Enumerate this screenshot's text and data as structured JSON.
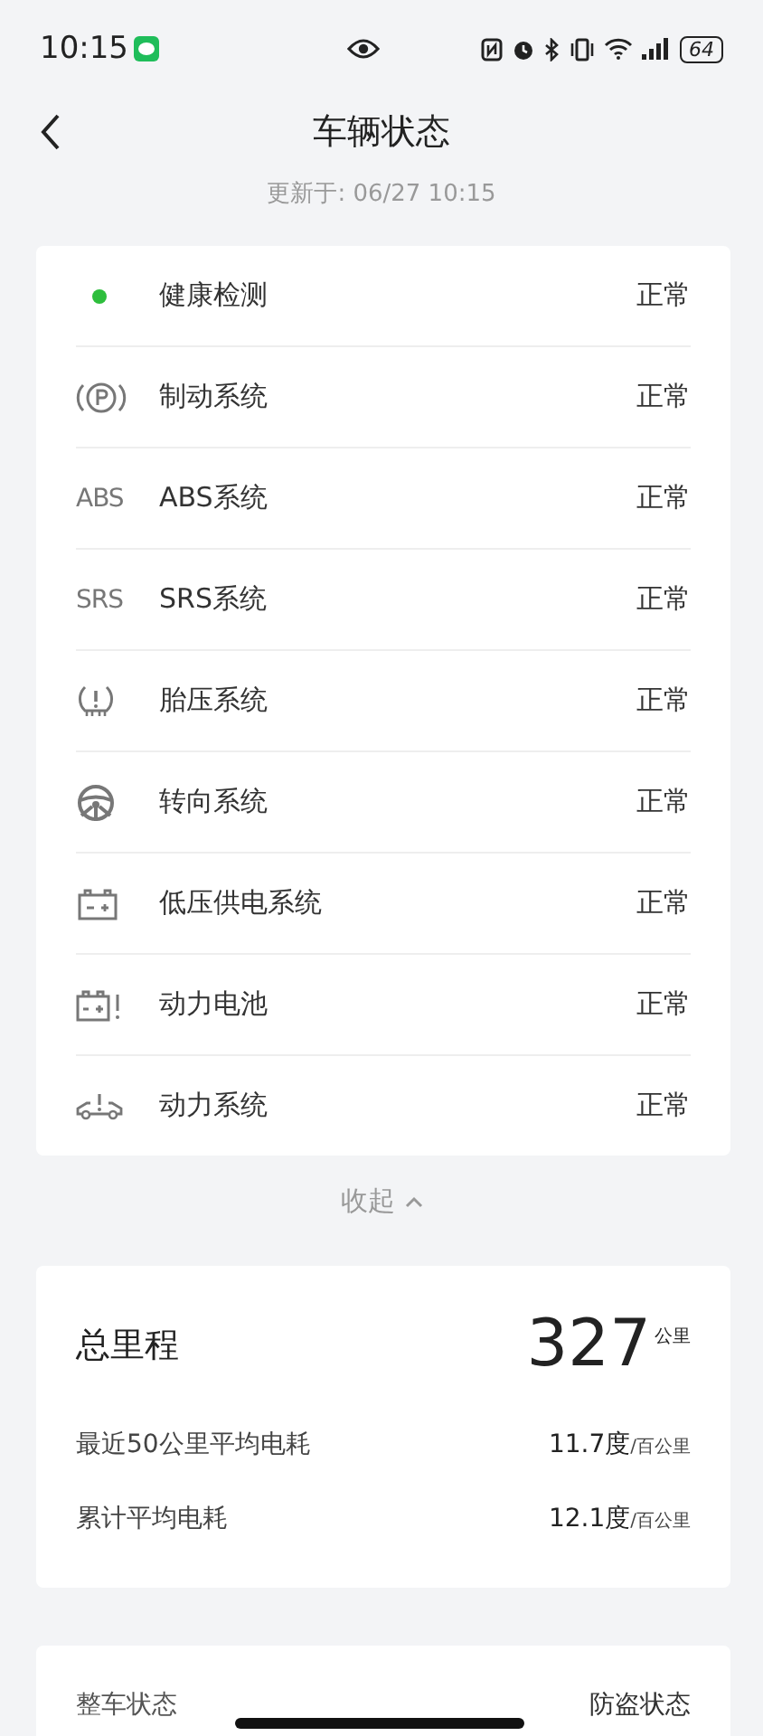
{
  "status_bar": {
    "time": "10:15",
    "battery": "64"
  },
  "header": {
    "title": "车辆状态",
    "updated": "更新于: 06/27 10:15"
  },
  "systems": [
    {
      "kind": "dot",
      "color": "#2dbe3c",
      "name": "健康检测",
      "status": "正常"
    },
    {
      "kind": "parking",
      "name": "制动系统",
      "status": "正常"
    },
    {
      "kind": "text",
      "icon_text": "ABS",
      "name": "ABS系统",
      "status": "正常"
    },
    {
      "kind": "text",
      "icon_text": "SRS",
      "name": "SRS系统",
      "status": "正常"
    },
    {
      "kind": "tire",
      "name": "胎压系统",
      "status": "正常"
    },
    {
      "kind": "steering",
      "name": "转向系统",
      "status": "正常"
    },
    {
      "kind": "battery",
      "name": "低压供电系统",
      "status": "正常"
    },
    {
      "kind": "battery-alert",
      "name": "动力电池",
      "status": "正常"
    },
    {
      "kind": "engine",
      "name": "动力系统",
      "status": "正常"
    }
  ],
  "collapse": {
    "label": "收起",
    "expanded": true
  },
  "mileage": {
    "title": "总里程",
    "value": "327",
    "unit": "公里",
    "rows": [
      {
        "label": "最近50公里平均电耗",
        "value": "11.7度",
        "unit": "/百公里"
      },
      {
        "label": "累计平均电耗",
        "value": "12.1度",
        "unit": "/百公里"
      }
    ]
  },
  "vehicle": {
    "left": "整车状态",
    "right": "防盗状态"
  }
}
